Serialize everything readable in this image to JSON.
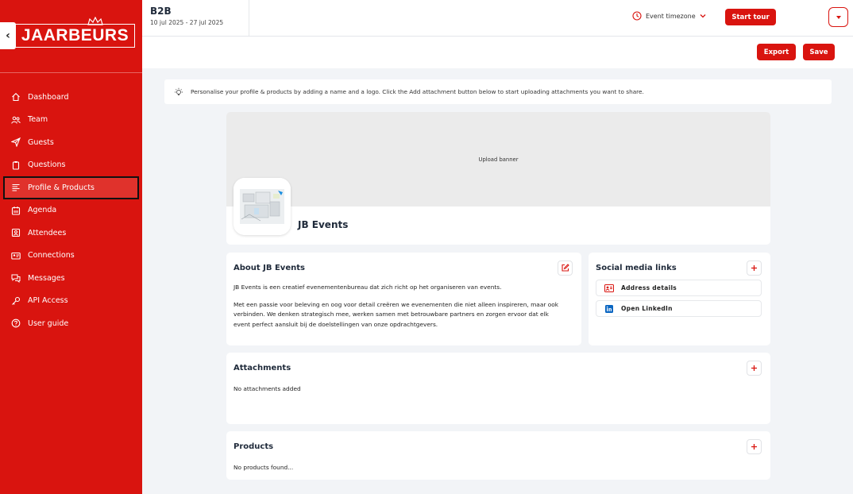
{
  "sidebar": {
    "logo_text": "JAARBEURS",
    "back_glyph": "‹",
    "items": [
      {
        "label": "Dashboard",
        "icon": "home-icon"
      },
      {
        "label": "Team",
        "icon": "team-icon"
      },
      {
        "label": "Guests",
        "icon": "send-icon"
      },
      {
        "label": "Questions",
        "icon": "clipboard-icon"
      },
      {
        "label": "Profile & Products",
        "icon": "list-icon",
        "active": true
      },
      {
        "label": "Agenda",
        "icon": "calendar-icon"
      },
      {
        "label": "Attendees",
        "icon": "contact-icon"
      },
      {
        "label": "Connections",
        "icon": "id-card-icon"
      },
      {
        "label": "Messages",
        "icon": "chat-icon"
      },
      {
        "label": "API Access",
        "icon": "key-icon"
      },
      {
        "label": "User guide",
        "icon": "help-icon"
      }
    ]
  },
  "header": {
    "event_title": "B2B",
    "event_dates": "10 jul 2025 - 27 jul 2025",
    "timezone_label": "Event timezone",
    "start_tour_label": "Start tour"
  },
  "toolbar": {
    "export_label": "Export",
    "save_label": "Save"
  },
  "info": {
    "text": "Personalise your profile & products by adding a name and a logo. Click the Add attachment button below to start uploading attachments you want to share."
  },
  "profile": {
    "banner_label": "Upload banner",
    "company_name": "JB Events"
  },
  "about": {
    "title": "About JB Events",
    "paragraph1": "JB Events is een creatief evenementenbureau dat zich richt op het organiseren van events.",
    "paragraph2": "Met een passie voor beleving en oog voor detail creëren we evenementen die niet alleen inspireren, maar ook verbinden. We denken strategisch mee, werken samen met betrouwbare partners en zorgen ervoor dat elk event perfect aansluit bij de doelstellingen van onze opdrachtgevers."
  },
  "social": {
    "title": "Social media links",
    "links": [
      {
        "label": "Address details",
        "icon": "address-card-icon"
      },
      {
        "label": "Open LinkedIn",
        "icon": "linkedin-icon"
      }
    ]
  },
  "attachments": {
    "title": "Attachments",
    "empty_text": "No attachments added"
  },
  "products": {
    "title": "Products",
    "empty_text": "No products found..."
  },
  "colors": {
    "brand_red": "#d9140f",
    "sidebar_active": "#e0322c",
    "page_bg": "#f2f4f7",
    "linkedin_blue": "#0a66c2"
  }
}
